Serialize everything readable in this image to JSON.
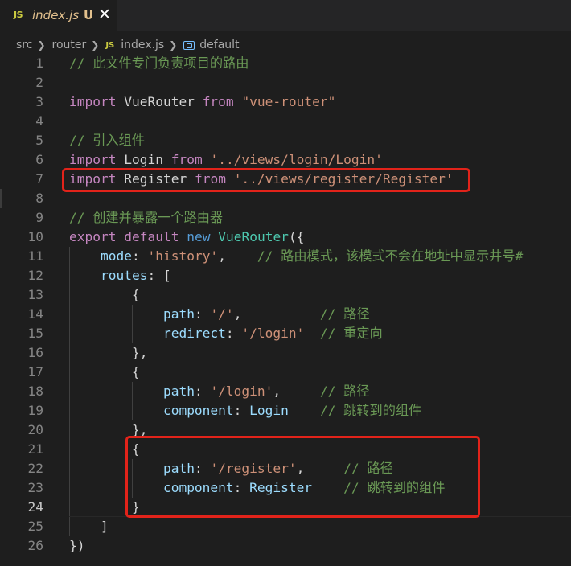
{
  "tab": {
    "icon": "JS",
    "title": "index.js",
    "status": "U",
    "close": "✕"
  },
  "breadcrumb": {
    "segments": [
      "src",
      "router",
      "index.js",
      "default"
    ],
    "file_icon": "JS"
  },
  "colors": {
    "highlight_box": "#e2231a",
    "background": "#1e1e1e"
  },
  "current_line": 24,
  "lines": [
    {
      "n": "1",
      "tokens": [
        [
          "cm",
          "// 此文件专门负责项目的路由"
        ]
      ]
    },
    {
      "n": "2",
      "tokens": []
    },
    {
      "n": "3",
      "tokens": [
        [
          "kw",
          "import"
        ],
        [
          "pl",
          " VueRouter "
        ],
        [
          "kw",
          "from"
        ],
        [
          "pl",
          " "
        ],
        [
          "str",
          "\"vue-router\""
        ]
      ]
    },
    {
      "n": "4",
      "tokens": []
    },
    {
      "n": "5",
      "tokens": [
        [
          "cm",
          "// 引入组件"
        ]
      ]
    },
    {
      "n": "6",
      "tokens": [
        [
          "kw",
          "import"
        ],
        [
          "pl",
          " Login "
        ],
        [
          "kw",
          "from"
        ],
        [
          "pl",
          " "
        ],
        [
          "str",
          "'../views/login/Login'"
        ]
      ]
    },
    {
      "n": "7",
      "tokens": [
        [
          "kw",
          "import"
        ],
        [
          "pl",
          " Register "
        ],
        [
          "kw",
          "from"
        ],
        [
          "pl",
          " "
        ],
        [
          "str",
          "'../views/register/Register'"
        ]
      ]
    },
    {
      "n": "8",
      "tokens": []
    },
    {
      "n": "9",
      "tokens": [
        [
          "cm",
          "// 创建并暴露一个路由器"
        ]
      ]
    },
    {
      "n": "10",
      "tokens": [
        [
          "kw",
          "export"
        ],
        [
          "pl",
          " "
        ],
        [
          "kw",
          "default"
        ],
        [
          "pl",
          " "
        ],
        [
          "kwb",
          "new"
        ],
        [
          "pl",
          " "
        ],
        [
          "cls",
          "VueRouter"
        ],
        [
          "pl",
          "({"
        ]
      ]
    },
    {
      "n": "11",
      "tokens": [
        [
          "pl",
          "    "
        ],
        [
          "prop",
          "mode"
        ],
        [
          "pl",
          ": "
        ],
        [
          "str",
          "'history'"
        ],
        [
          "pl",
          ",    "
        ],
        [
          "cm",
          "// 路由模式，该模式不会在地址中显示井号#"
        ]
      ]
    },
    {
      "n": "12",
      "tokens": [
        [
          "pl",
          "    "
        ],
        [
          "prop",
          "routes"
        ],
        [
          "pl",
          ": ["
        ]
      ]
    },
    {
      "n": "13",
      "tokens": [
        [
          "pl",
          "        {"
        ]
      ]
    },
    {
      "n": "14",
      "tokens": [
        [
          "pl",
          "            "
        ],
        [
          "prop",
          "path"
        ],
        [
          "pl",
          ": "
        ],
        [
          "str",
          "'/'"
        ],
        [
          "pl",
          ",          "
        ],
        [
          "cm",
          "// 路径"
        ]
      ]
    },
    {
      "n": "15",
      "tokens": [
        [
          "pl",
          "            "
        ],
        [
          "prop",
          "redirect"
        ],
        [
          "pl",
          ": "
        ],
        [
          "str",
          "'/login'"
        ],
        [
          "pl",
          "  "
        ],
        [
          "cm",
          "// 重定向"
        ]
      ]
    },
    {
      "n": "16",
      "tokens": [
        [
          "pl",
          "        },"
        ]
      ]
    },
    {
      "n": "17",
      "tokens": [
        [
          "pl",
          "        {"
        ]
      ]
    },
    {
      "n": "18",
      "tokens": [
        [
          "pl",
          "            "
        ],
        [
          "prop",
          "path"
        ],
        [
          "pl",
          ": "
        ],
        [
          "str",
          "'/login'"
        ],
        [
          "pl",
          ",     "
        ],
        [
          "cm",
          "// 路径"
        ]
      ]
    },
    {
      "n": "19",
      "tokens": [
        [
          "pl",
          "            "
        ],
        [
          "prop",
          "component"
        ],
        [
          "pl",
          ": "
        ],
        [
          "prop",
          "Login"
        ],
        [
          "pl",
          "    "
        ],
        [
          "cm",
          "// 跳转到的组件"
        ]
      ]
    },
    {
      "n": "20",
      "tokens": [
        [
          "pl",
          "        },"
        ]
      ]
    },
    {
      "n": "21",
      "tokens": [
        [
          "pl",
          "        {"
        ]
      ]
    },
    {
      "n": "22",
      "tokens": [
        [
          "pl",
          "            "
        ],
        [
          "prop",
          "path"
        ],
        [
          "pl",
          ": "
        ],
        [
          "str",
          "'/register'"
        ],
        [
          "pl",
          ",     "
        ],
        [
          "cm",
          "// 路径"
        ]
      ]
    },
    {
      "n": "23",
      "tokens": [
        [
          "pl",
          "            "
        ],
        [
          "prop",
          "component"
        ],
        [
          "pl",
          ": "
        ],
        [
          "prop",
          "Register"
        ],
        [
          "pl",
          "    "
        ],
        [
          "cm",
          "// 跳转到的组件"
        ]
      ]
    },
    {
      "n": "24",
      "tokens": [
        [
          "pl",
          "        }"
        ]
      ]
    },
    {
      "n": "25",
      "tokens": [
        [
          "pl",
          "    ]"
        ]
      ]
    },
    {
      "n": "26",
      "tokens": [
        [
          "pl",
          "})"
        ]
      ]
    }
  ]
}
